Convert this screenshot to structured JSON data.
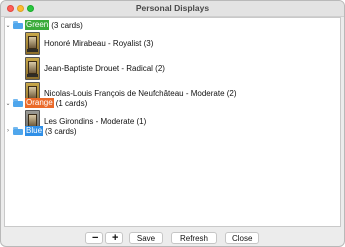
{
  "window": {
    "title": "Personal Displays"
  },
  "colors": {
    "green": "#3aab3a",
    "orange": "#ea6a2a",
    "blue": "#2f8fe7"
  },
  "tree": {
    "groups": [
      {
        "name": "Green",
        "count_label": "(3 cards)",
        "expanded": true,
        "items": [
          {
            "label": "Honoré Mirabeau - Royalist (3)"
          },
          {
            "label": "Jean-Baptiste Drouet - Radical (2)"
          },
          {
            "label": "Nicolas-Louis François de Neufchâteau - Moderate (2)"
          }
        ]
      },
      {
        "name": "Orange",
        "count_label": "(1 cards)",
        "expanded": true,
        "items": [
          {
            "label": "Les Girondins - Moderate (1)"
          }
        ]
      },
      {
        "name": "Blue",
        "count_label": "(3 cards)",
        "expanded": false,
        "items": []
      }
    ]
  },
  "toolbar": {
    "remove_icon": "minus-icon",
    "add_icon": "plus-icon",
    "save_label": "Save",
    "refresh_label": "Refresh",
    "close_label": "Close"
  }
}
